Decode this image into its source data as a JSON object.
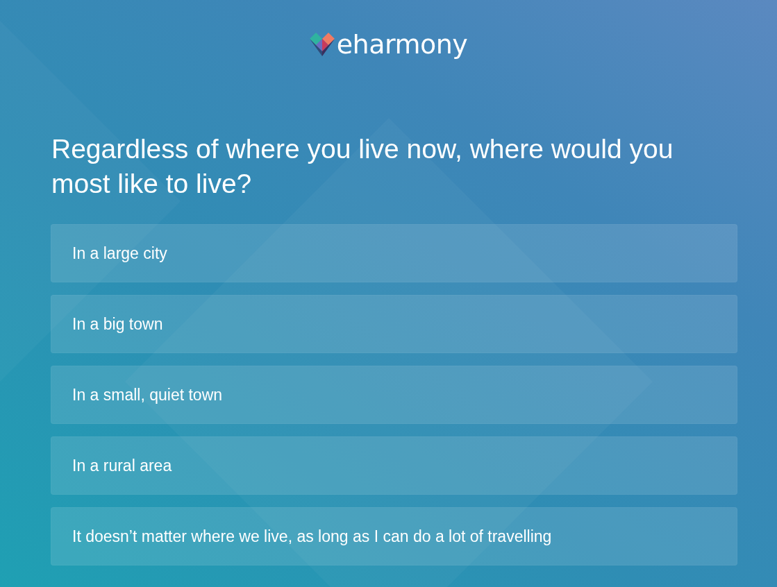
{
  "header": {
    "logo": {
      "text": "eharmony"
    }
  },
  "question": {
    "text": "Regardless of where you live now, where would you most like to live?"
  },
  "options": [
    {
      "label": "In a large city",
      "selected": false
    },
    {
      "label": "In a big town",
      "selected": false
    },
    {
      "label": "In a small, quiet town",
      "selected": false
    },
    {
      "label": "In a rural area",
      "selected": false
    },
    {
      "label": "It doesn’t matter where we live, as long as I can do a lot of travelling",
      "selected": false
    }
  ]
}
